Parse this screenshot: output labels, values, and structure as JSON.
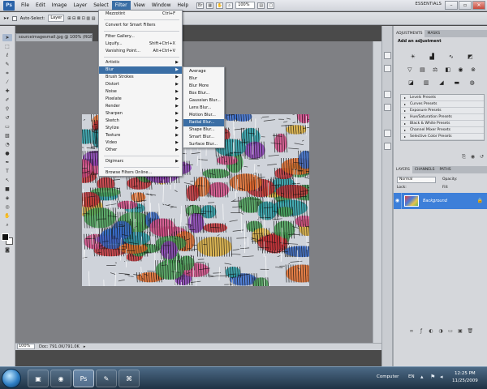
{
  "app": {
    "logo": "Ps",
    "menu": [
      "File",
      "Edit",
      "Image",
      "Layer",
      "Select",
      "Filter",
      "View",
      "Window",
      "Help"
    ],
    "active_menu": "Filter",
    "zoom": "100%",
    "workspace": "ESSENTIALS"
  },
  "options_bar": {
    "auto_select_label": "Auto-Select:",
    "auto_select_value": "Layer"
  },
  "document": {
    "tab_title": "sourceimagesmall.jpg @ 100% (RGB/8#)",
    "status_zoom": "100%",
    "status_doc": "Doc: 791.0K/791.0K"
  },
  "filter_menu": {
    "top_item": {
      "label": "Mezzotint",
      "shortcut": "Ctrl+F"
    },
    "convert": "Convert for Smart Filters",
    "gallery": "Filter Gallery...",
    "liquify": {
      "label": "Liquify...",
      "shortcut": "Shift+Ctrl+X"
    },
    "vanishing": {
      "label": "Vanishing Point...",
      "shortcut": "Alt+Ctrl+V"
    },
    "groups": [
      "Artistic",
      "Blur",
      "Brush Strokes",
      "Distort",
      "Noise",
      "Pixelate",
      "Render",
      "Sharpen",
      "Sketch",
      "Stylize",
      "Texture",
      "Video",
      "Other"
    ],
    "highlighted_group": "Blur",
    "digimarc": "Digimarc",
    "browse": "Browse Filters Online..."
  },
  "blur_menu": {
    "items": [
      "Average",
      "Blur",
      "Blur More",
      "Box Blur...",
      "Gaussian Blur...",
      "Lens Blur...",
      "Motion Blur...",
      "Radial Blur...",
      "Shape Blur...",
      "Smart Blur...",
      "Surface Blur..."
    ],
    "highlighted": "Radial Blur..."
  },
  "adjustments_panel": {
    "tabs": [
      "ADJUSTMENTS",
      "MASKS"
    ],
    "title": "Add an adjustment",
    "presets": [
      "Levels Presets",
      "Curves Presets",
      "Exposure Presets",
      "Hue/Saturation Presets",
      "Black & White Presets",
      "Channel Mixer Presets",
      "Selective Color Presets"
    ]
  },
  "layers_panel": {
    "tabs": [
      "LAYERS",
      "CHANNELS",
      "PATHS"
    ],
    "blend_mode": "Normal",
    "opacity_label": "Opacity:",
    "lock_label": "Lock:",
    "fill_label": "Fill:",
    "layer_name": "Background"
  },
  "taskbar": {
    "tray_label": "Computer",
    "language": "EN",
    "time": "12:25 PM",
    "date": "11/25/2009"
  },
  "colors": {
    "menu_highlight": "#3a6ea5",
    "layer_selected": "#3d7fd9",
    "canvas_bg": "#7f8084"
  }
}
